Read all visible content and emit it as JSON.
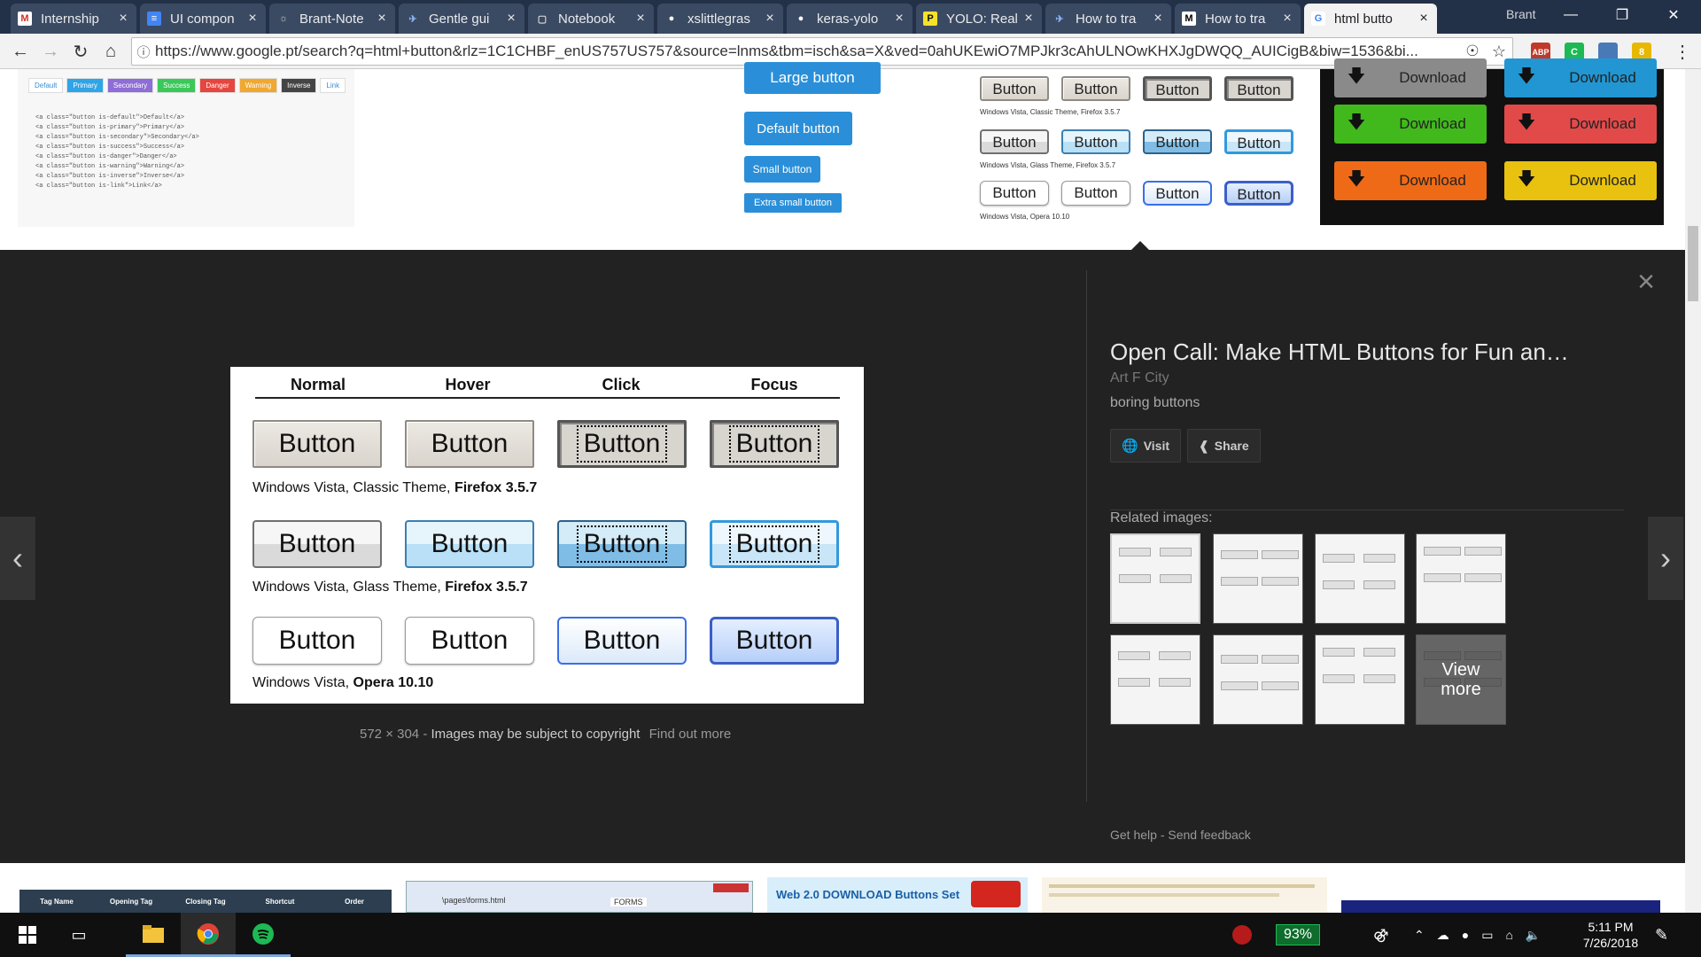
{
  "tabs": [
    {
      "label": "Internship",
      "icon": "gmail-icon",
      "active": false
    },
    {
      "label": "UI compon",
      "icon": "docs-icon",
      "active": false
    },
    {
      "label": "Brant-Note",
      "icon": "notebook-icon",
      "active": false
    },
    {
      "label": "Gentle gui",
      "icon": "web-icon",
      "active": false
    },
    {
      "label": "Notebook",
      "icon": "file-icon",
      "active": false
    },
    {
      "label": "xslittlegras",
      "icon": "github-icon",
      "active": false
    },
    {
      "label": "keras-yolo",
      "icon": "github-icon",
      "active": false
    },
    {
      "label": "YOLO: Real",
      "icon": "pj-icon",
      "active": false
    },
    {
      "label": "How to tra",
      "icon": "web-icon",
      "active": false
    },
    {
      "label": "How to tra",
      "icon": "medium-icon",
      "active": false
    },
    {
      "label": "html butto",
      "icon": "google-icon",
      "active": true
    }
  ],
  "profile_name": "Brant",
  "url": "https://www.google.pt/search?q=html+button&rlz=1C1CHBF_enUS757US757&source=lnms&tbm=isch&sa=X&ved=0ahUKEwiO7MPJkr3cAhULNOwKHXJgDWQQ_AUICigB&biw=1536&bi...",
  "extensions": {
    "abp": "ABP",
    "abp_count": "1",
    "green": "C",
    "ext_count": "8"
  },
  "top_strip": {
    "color_tags": [
      "Default",
      "Primary",
      "Secondary",
      "Success",
      "Danger",
      "Warning",
      "Inverse",
      "Link"
    ],
    "code_lines": [
      "<a class=\"button is-default\">Default</a>",
      "<a class=\"button is-primary\">Primary</a>",
      "<a class=\"button is-secondary\">Secondary</a>",
      "<a class=\"button is-success\">Success</a>",
      "<a class=\"button is-danger\">Danger</a>",
      "<a class=\"button is-warning\">Warning</a>",
      "<a class=\"button is-inverse\">Inverse</a>",
      "<a class=\"button is-link\">Link</a>"
    ],
    "blue_buttons": [
      "Large button",
      "Default button",
      "Small button",
      "Extra small button"
    ],
    "vista_button": "Button",
    "vista_caps": [
      "Windows Vista, Classic Theme, Firefox 3.5.7",
      "Windows Vista, Glass Theme, Firefox 3.5.7",
      "Windows Vista, Opera 10.10"
    ],
    "download_label": "Download"
  },
  "preview": {
    "headers": [
      "Normal",
      "Hover",
      "Click",
      "Focus"
    ],
    "button_label": "Button",
    "rows": [
      {
        "caption_plain": "Windows Vista, Classic Theme, ",
        "caption_bold": "Firefox 3.5.7"
      },
      {
        "caption_plain": "Windows Vista, Glass Theme, ",
        "caption_bold": "Firefox 3.5.7"
      },
      {
        "caption_plain": "Windows Vista, ",
        "caption_bold": "Opera 10.10"
      }
    ],
    "size": "572 × 304",
    "copyright": "Images may be subject to copyright",
    "find_out": "Find out more"
  },
  "result": {
    "title": "Open Call: Make HTML Buttons for Fun an…",
    "source": "Art F City",
    "desc": "boring buttons",
    "visit": "Visit",
    "share": "Share",
    "related": "Related images:",
    "view_more": "View more",
    "get_help": "Get help",
    "send_feedback": "Send feedback",
    "sep": "-"
  },
  "bottom_strip": {
    "table_headers": [
      "Tag Name",
      "Opening Tag",
      "Closing Tag",
      "Shortcut",
      "Order"
    ],
    "forms_path": "\\pages\\forms.html",
    "forms_tab": "FORMS",
    "web20": "Web 2.0 DOWNLOAD Buttons Set"
  },
  "taskbar": {
    "battery": "93%",
    "time": "5:11 PM",
    "date": "7/26/2018"
  }
}
